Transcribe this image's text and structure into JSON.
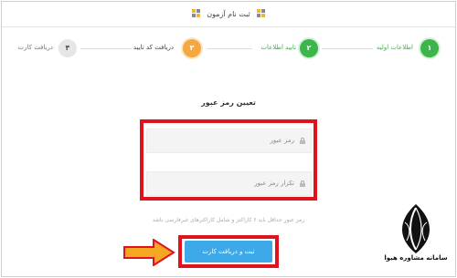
{
  "header": {
    "title": "ثبت نام آزمون"
  },
  "steps": [
    {
      "number": "۱",
      "label": "اطلاعات اولیه",
      "state": "done",
      "color": "#3cb54a"
    },
    {
      "number": "۲",
      "label": "تایید اطلاعات",
      "state": "done",
      "color": "#3cb54a"
    },
    {
      "number": "۳",
      "label": "دریافت کد تایید",
      "state": "current",
      "color": "#f5a742"
    },
    {
      "number": "۴",
      "label": "دریافت کارت",
      "state": "pending",
      "color": "#e6e6e6"
    }
  ],
  "form": {
    "title": "تعیین رمز عبور",
    "password_placeholder": "رمز عبور",
    "confirm_placeholder": "تکرار رمز عبور",
    "hint": "رمز عبور حداقل باید ۶ کاراکتر و شامل کاراکترهای غیرفارسی باشد",
    "submit_label": "ثبت و دریافت کارت"
  },
  "watermark": {
    "text": "سامانه مشاوره هیوا"
  },
  "colors": {
    "accent": "#3da9e8",
    "highlight": "#e0121c",
    "arrow": "#f5a623",
    "success": "#3cb54a"
  },
  "icons": {
    "lock": "lock-icon",
    "arrow": "arrow-right-icon"
  }
}
